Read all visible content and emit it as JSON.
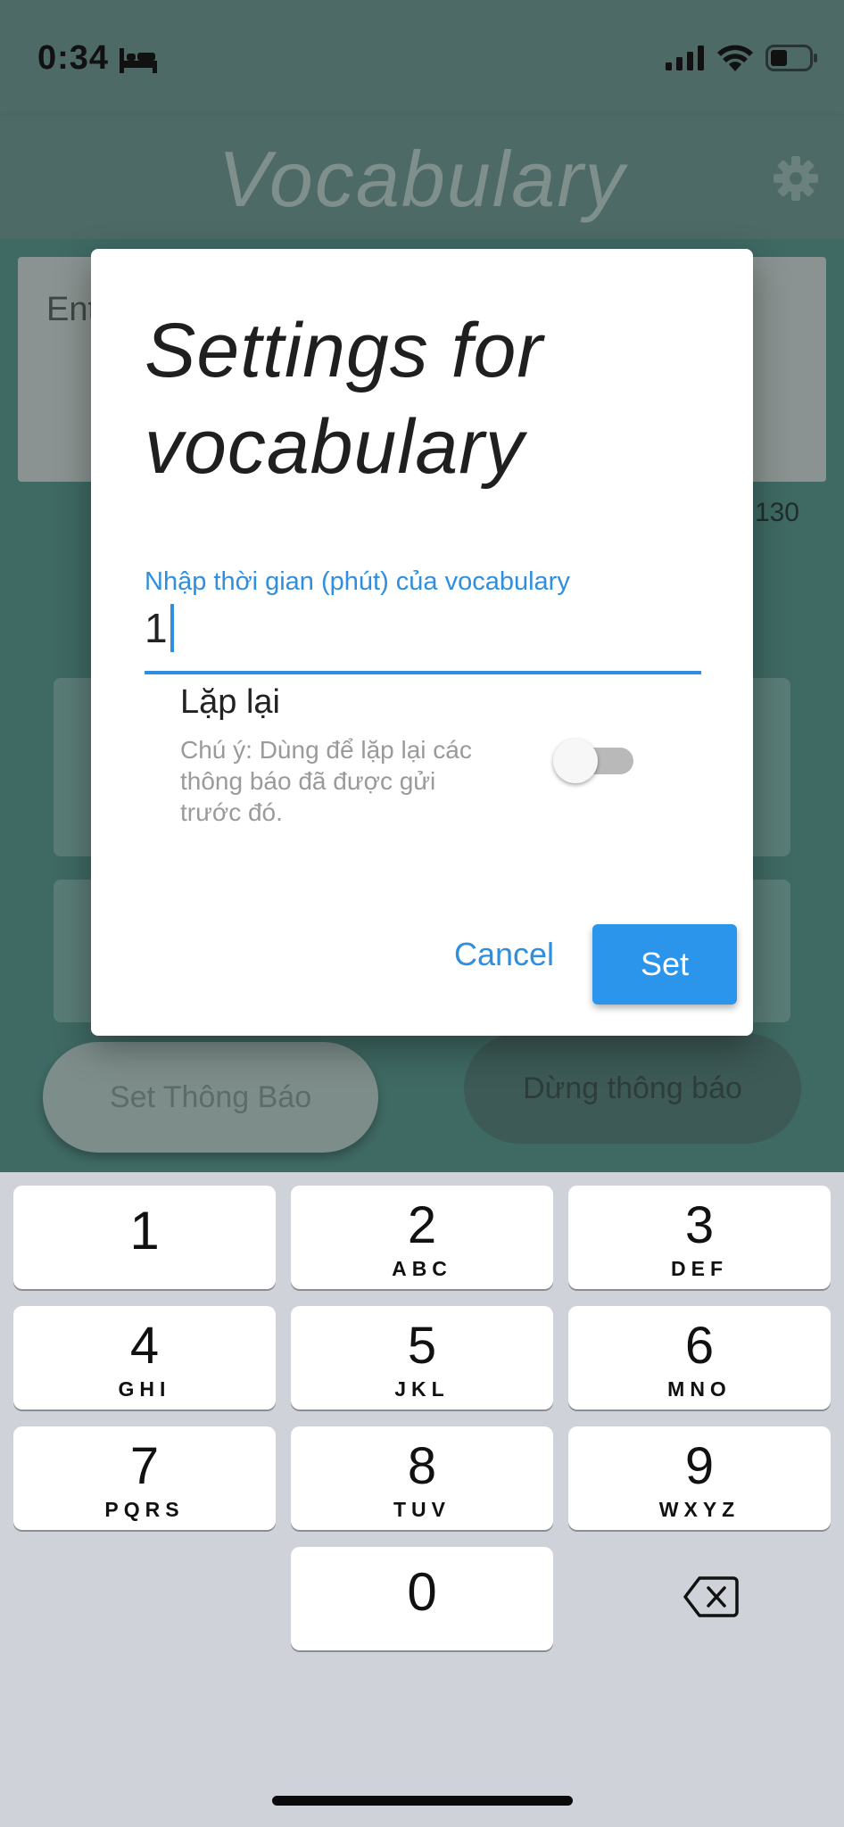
{
  "status_bar": {
    "time": "0:34",
    "sleep_icon": "bed-icon",
    "signal_icon": "signal-icon",
    "wifi_icon": "wifi-icon",
    "battery_icon": "battery-icon"
  },
  "app_bar": {
    "title": "Vocabulary",
    "settings_icon": "gear-icon"
  },
  "background": {
    "input_hint": "Ent",
    "counter": "130",
    "set_button": "Set Thông Báo",
    "stop_button": "Dừng thông báo"
  },
  "dialog": {
    "title": "Settings for vocabulary",
    "field_label": "Nhập thời gian (phút) của vocabulary",
    "field_value": "1",
    "switch_title": "Lặp lại",
    "switch_subtitle": "Chú ý: Dùng để lặp lại các thông báo đã được gửi trước đó.",
    "switch_on": false,
    "cancel_label": "Cancel",
    "set_label": "Set"
  },
  "keyboard": {
    "keys": [
      {
        "num": "1",
        "letters": ""
      },
      {
        "num": "2",
        "letters": "ABC"
      },
      {
        "num": "3",
        "letters": "DEF"
      },
      {
        "num": "4",
        "letters": "GHI"
      },
      {
        "num": "5",
        "letters": "JKL"
      },
      {
        "num": "6",
        "letters": "MNO"
      },
      {
        "num": "7",
        "letters": "PQRS"
      },
      {
        "num": "8",
        "letters": "TUV"
      },
      {
        "num": "9",
        "letters": "WXYZ"
      },
      {
        "num": "0",
        "letters": ""
      }
    ],
    "delete_icon": "backspace-icon"
  },
  "colors": {
    "accent": "#2f8fde",
    "scrim_app": "#4d6a66",
    "keyboard_bg": "#cfd3d9"
  }
}
